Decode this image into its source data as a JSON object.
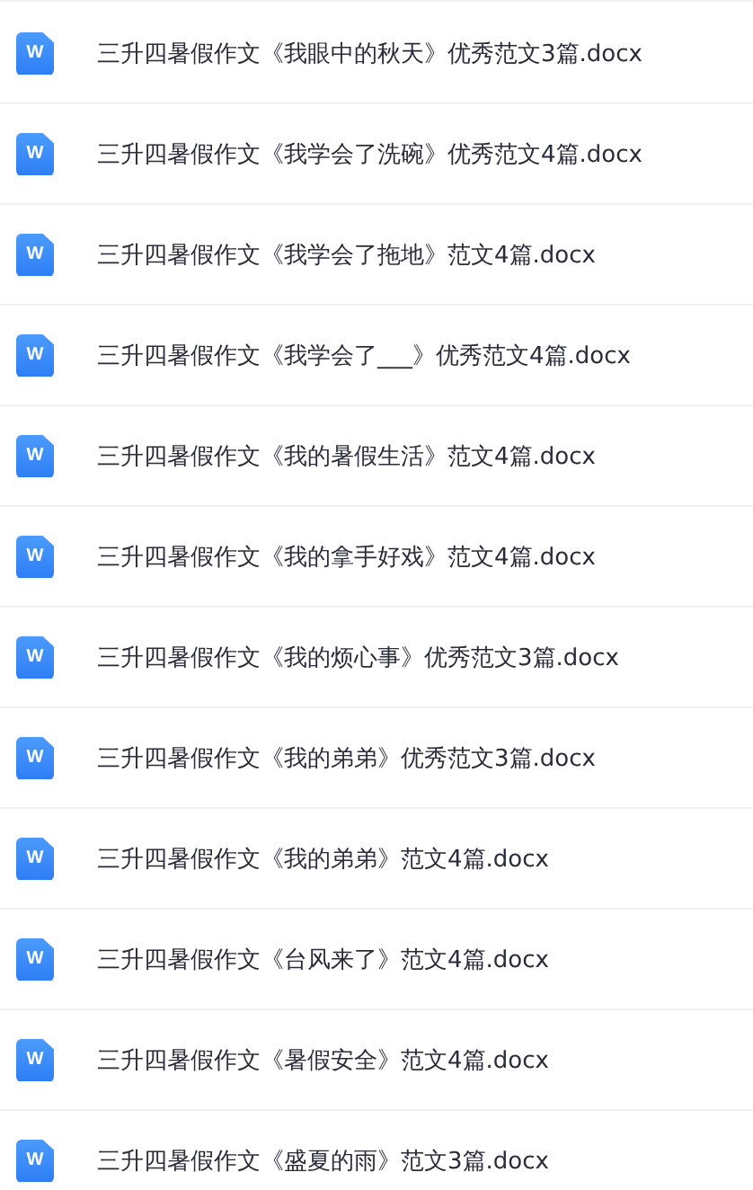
{
  "files": [
    {
      "icon_letter": "W",
      "name": "三升四暑假作文《我眼中的秋天》优秀范文3篇.docx"
    },
    {
      "icon_letter": "W",
      "name": "三升四暑假作文《我学会了洗碗》优秀范文4篇.docx"
    },
    {
      "icon_letter": "W",
      "name": "三升四暑假作文《我学会了拖地》范文4篇.docx"
    },
    {
      "icon_letter": "W",
      "name": "三升四暑假作文《我学会了___》优秀范文4篇.docx"
    },
    {
      "icon_letter": "W",
      "name": "三升四暑假作文《我的暑假生活》范文4篇.docx"
    },
    {
      "icon_letter": "W",
      "name": "三升四暑假作文《我的拿手好戏》范文4篇.docx"
    },
    {
      "icon_letter": "W",
      "name": "三升四暑假作文《我的烦心事》优秀范文3篇.docx"
    },
    {
      "icon_letter": "W",
      "name": "三升四暑假作文《我的弟弟》优秀范文3篇.docx"
    },
    {
      "icon_letter": "W",
      "name": "三升四暑假作文《我的弟弟》范文4篇.docx"
    },
    {
      "icon_letter": "W",
      "name": "三升四暑假作文《台风来了》范文4篇.docx"
    },
    {
      "icon_letter": "W",
      "name": "三升四暑假作文《暑假安全》范文4篇.docx"
    },
    {
      "icon_letter": "W",
      "name": "三升四暑假作文《盛夏的雨》范文3篇.docx"
    }
  ]
}
